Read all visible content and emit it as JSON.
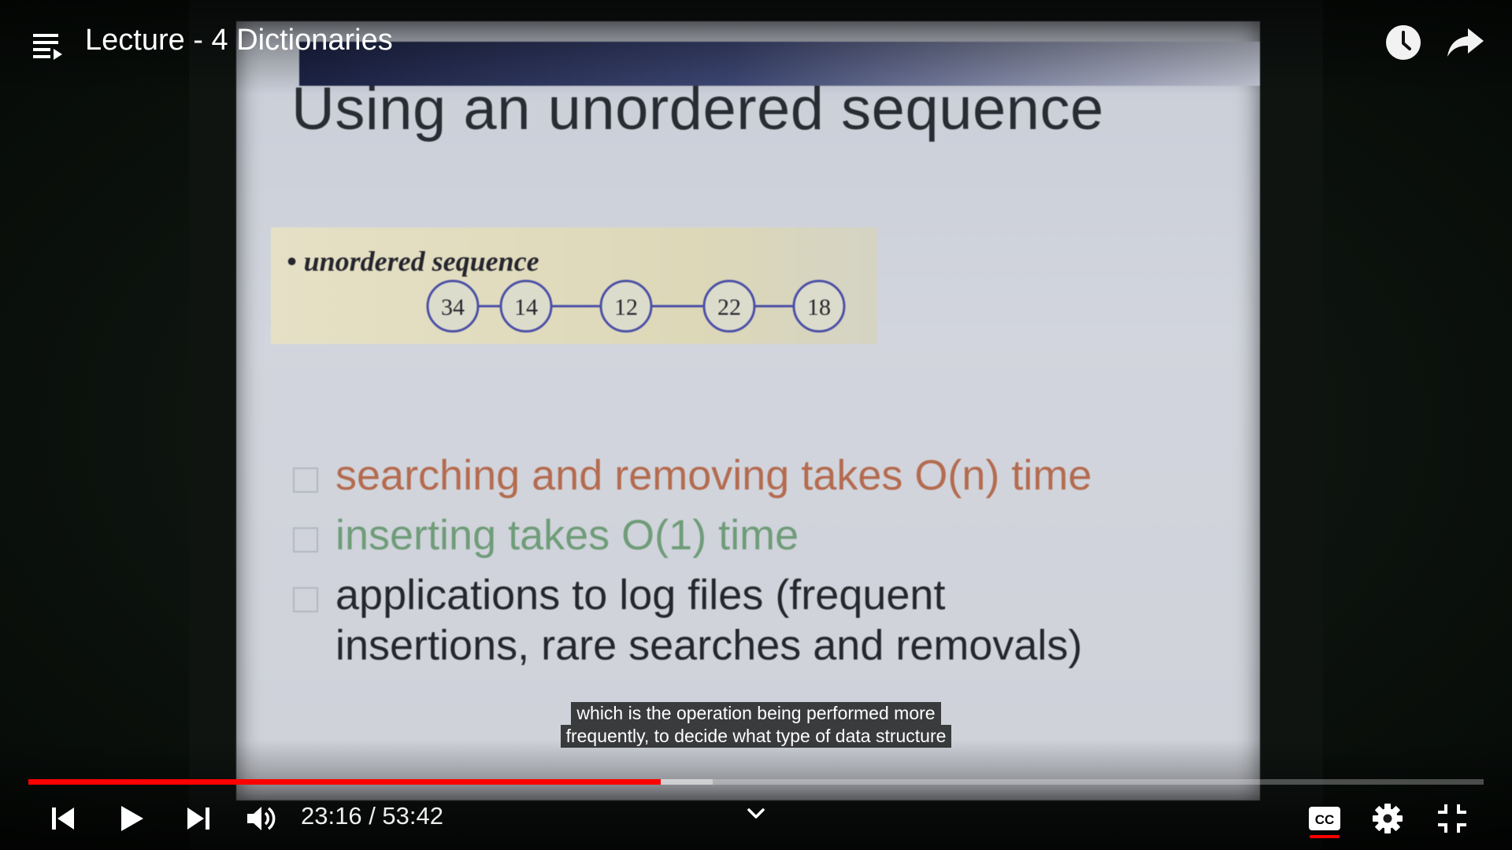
{
  "header": {
    "title": "Lecture - 4 Dictionaries"
  },
  "slide": {
    "title": "Using an unordered sequence",
    "bullet": "unordered sequence",
    "nodes": [
      "34",
      "14",
      "12",
      "22",
      "18"
    ],
    "points": [
      "searching and removing takes O(n) time",
      "inserting takes O(1) time",
      "applications to log files (frequent",
      "insertions, rare searches and removals)"
    ]
  },
  "captions": {
    "line1": "which is the operation being performed more",
    "line2": "frequently, to decide what type of data structure"
  },
  "player": {
    "time": "23:16 / 53:42",
    "progress_played": 0.4345,
    "progress_buffered": 0.4705,
    "captions_on": true,
    "colors": {
      "progress": "#ff0000",
      "slide_point_1": "#b46b4f",
      "slide_point_2": "#6f9c79"
    }
  }
}
